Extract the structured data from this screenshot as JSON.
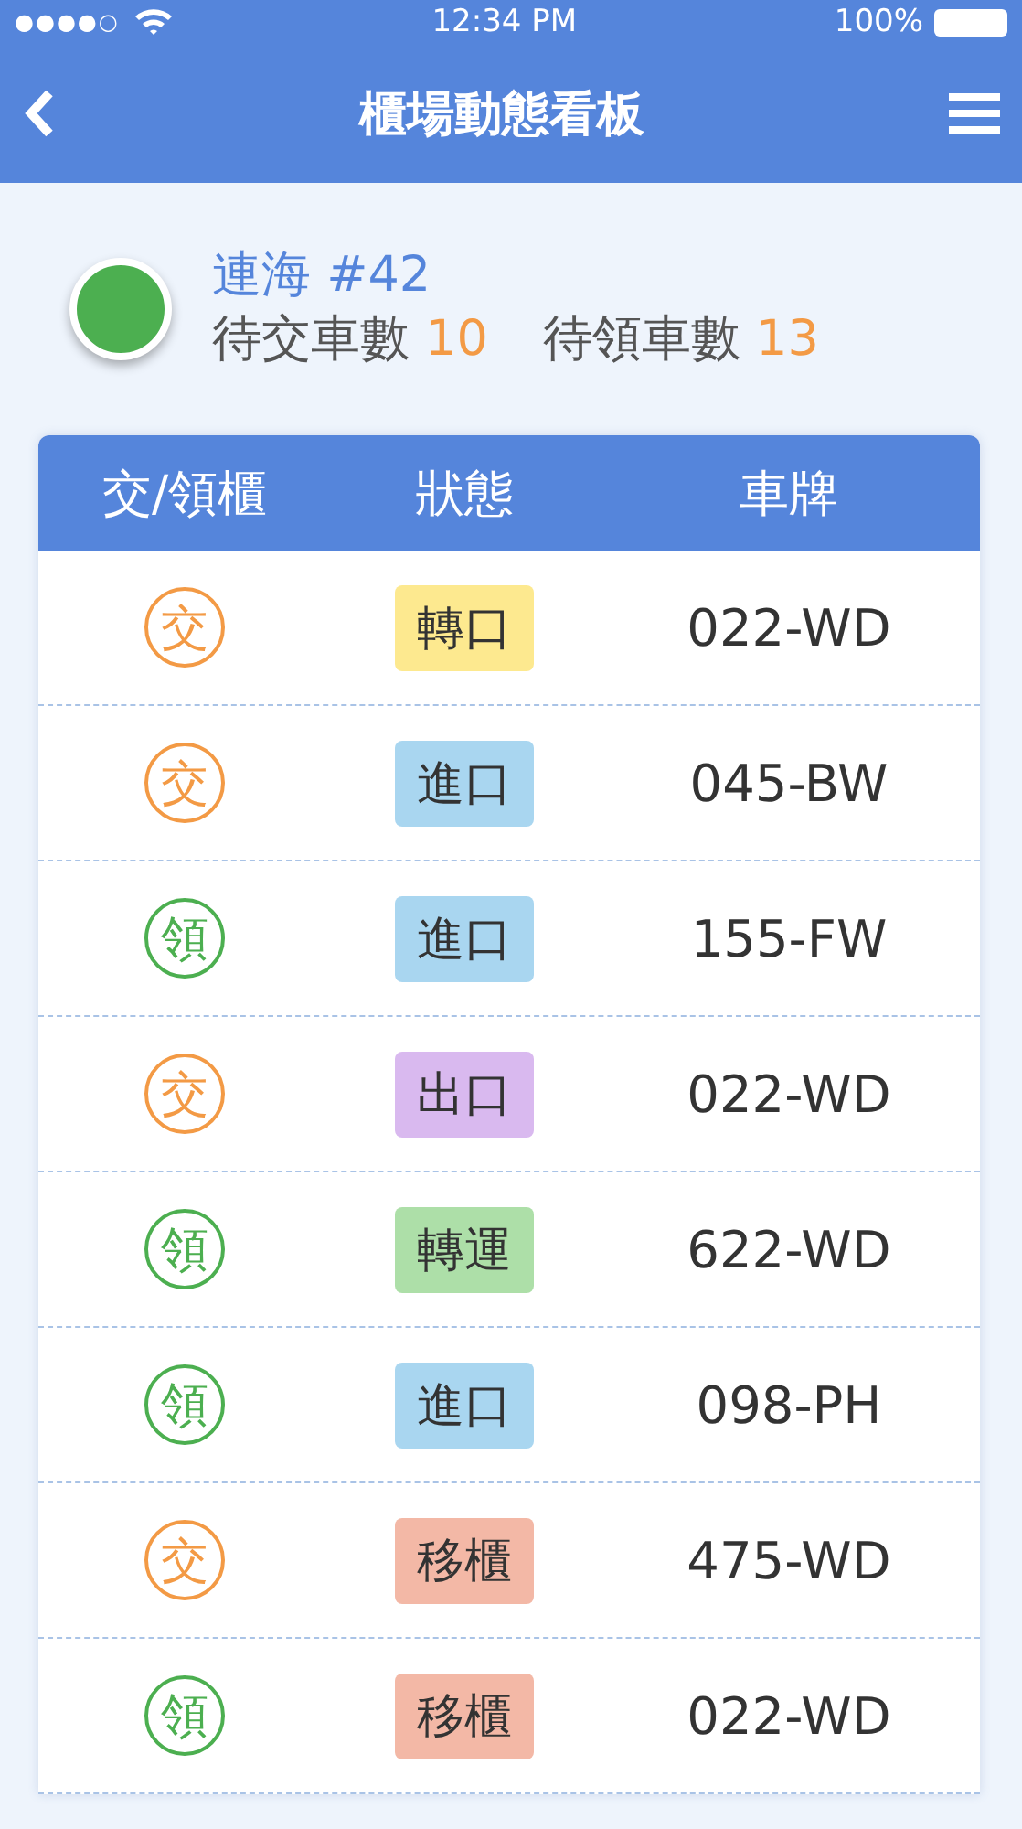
{
  "status_bar": {
    "signal_dots": "●●●●○",
    "time": "12:34 PM",
    "battery": "100%"
  },
  "nav": {
    "title": "櫃場動態看板"
  },
  "terminal": {
    "color": "#4caf50",
    "name": "連海 #42",
    "pending_drop_label": "待交車數",
    "pending_drop": "10",
    "pending_pick_label": "待領車數",
    "pending_pick": "13"
  },
  "table": {
    "columns": [
      "交/領櫃",
      "狀態",
      "車牌"
    ],
    "rows": [
      {
        "counter": {
          "text": "交",
          "color": "#f39a45"
        },
        "status": {
          "text": "轉口",
          "color": "#fde98f"
        },
        "plate": "022-WD"
      },
      {
        "counter": {
          "text": "交",
          "color": "#f39a45"
        },
        "status": {
          "text": "進口",
          "color": "#a9d6f0"
        },
        "plate": "045-BW"
      },
      {
        "counter": {
          "text": "領",
          "color": "#4caf50"
        },
        "status": {
          "text": "進口",
          "color": "#a9d6f0"
        },
        "plate": "155-FW"
      },
      {
        "counter": {
          "text": "交",
          "color": "#f39a45"
        },
        "status": {
          "text": "出口",
          "color": "#d9b9ef"
        },
        "plate": "022-WD"
      },
      {
        "counter": {
          "text": "領",
          "color": "#4caf50"
        },
        "status": {
          "text": "轉運",
          "color": "#addfa8"
        },
        "plate": "622-WD"
      },
      {
        "counter": {
          "text": "領",
          "color": "#4caf50"
        },
        "status": {
          "text": "進口",
          "color": "#a9d6f0"
        },
        "plate": "098-PH"
      },
      {
        "counter": {
          "text": "交",
          "color": "#f39a45"
        },
        "status": {
          "text": "移櫃",
          "color": "#f3b8a6"
        },
        "plate": "475-WD"
      },
      {
        "counter": {
          "text": "領",
          "color": "#4caf50"
        },
        "status": {
          "text": "移櫃",
          "color": "#f3b8a6"
        },
        "plate": "022-WD"
      }
    ]
  }
}
